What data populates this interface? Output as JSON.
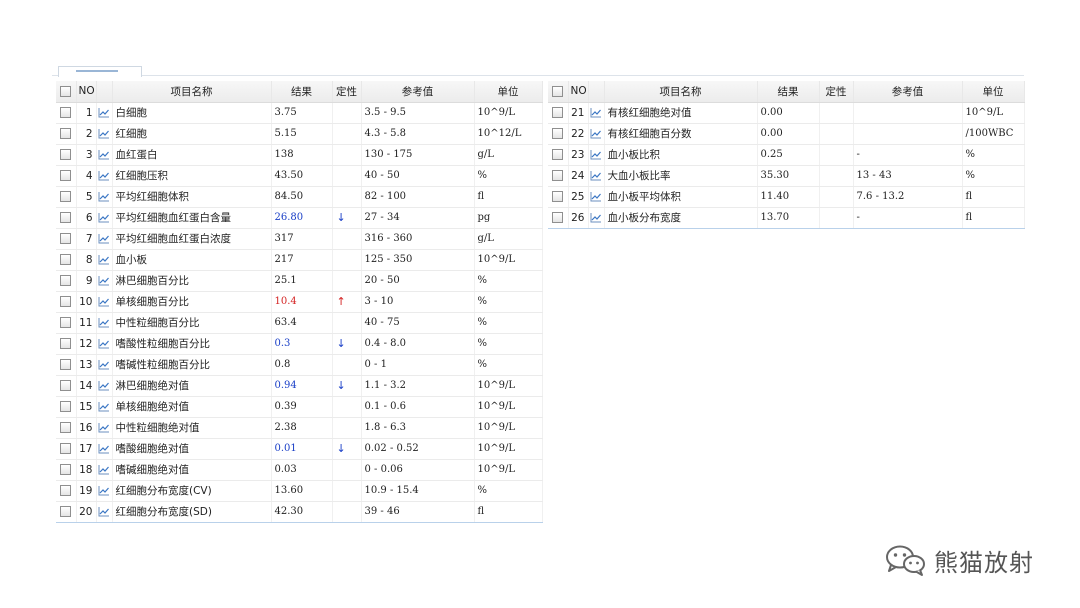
{
  "headers": {
    "no": "NO",
    "name": "项目名称",
    "result": "结果",
    "flag": "定性",
    "ref": "参考值",
    "unit": "单位"
  },
  "left_rows": [
    {
      "no": "1",
      "name": "白细胞",
      "result": "3.75",
      "flag": "",
      "ref": "3.5 - 9.5",
      "unit": "10^9/L",
      "status": "normal"
    },
    {
      "no": "2",
      "name": "红细胞",
      "result": "5.15",
      "flag": "",
      "ref": "4.3 - 5.8",
      "unit": "10^12/L",
      "status": "normal"
    },
    {
      "no": "3",
      "name": "血红蛋白",
      "result": "138",
      "flag": "",
      "ref": "130 - 175",
      "unit": "g/L",
      "status": "normal"
    },
    {
      "no": "4",
      "name": "红细胞压积",
      "result": "43.50",
      "flag": "",
      "ref": "40 - 50",
      "unit": "%",
      "status": "normal"
    },
    {
      "no": "5",
      "name": "平均红细胞体积",
      "result": "84.50",
      "flag": "",
      "ref": "82 - 100",
      "unit": "fl",
      "status": "normal"
    },
    {
      "no": "6",
      "name": "平均红细胞血红蛋白含量",
      "result": "26.80",
      "flag": "↓",
      "ref": "27 - 34",
      "unit": "pg",
      "status": "low"
    },
    {
      "no": "7",
      "name": "平均红细胞血红蛋白浓度",
      "result": "317",
      "flag": "",
      "ref": "316 - 360",
      "unit": "g/L",
      "status": "normal"
    },
    {
      "no": "8",
      "name": "血小板",
      "result": "217",
      "flag": "",
      "ref": "125 - 350",
      "unit": "10^9/L",
      "status": "normal"
    },
    {
      "no": "9",
      "name": "淋巴细胞百分比",
      "result": "25.1",
      "flag": "",
      "ref": "20 - 50",
      "unit": "%",
      "status": "normal"
    },
    {
      "no": "10",
      "name": "单核细胞百分比",
      "result": "10.4",
      "flag": "↑",
      "ref": "3 - 10",
      "unit": "%",
      "status": "high"
    },
    {
      "no": "11",
      "name": "中性粒细胞百分比",
      "result": "63.4",
      "flag": "",
      "ref": "40 - 75",
      "unit": "%",
      "status": "normal"
    },
    {
      "no": "12",
      "name": "嗜酸性粒细胞百分比",
      "result": "0.3",
      "flag": "↓",
      "ref": "0.4 - 8.0",
      "unit": "%",
      "status": "low"
    },
    {
      "no": "13",
      "name": "嗜碱性粒细胞百分比",
      "result": "0.8",
      "flag": "",
      "ref": "0 - 1",
      "unit": "%",
      "status": "normal"
    },
    {
      "no": "14",
      "name": "淋巴细胞绝对值",
      "result": "0.94",
      "flag": "↓",
      "ref": "1.1 - 3.2",
      "unit": "10^9/L",
      "status": "low"
    },
    {
      "no": "15",
      "name": "单核细胞绝对值",
      "result": "0.39",
      "flag": "",
      "ref": "0.1 - 0.6",
      "unit": "10^9/L",
      "status": "normal"
    },
    {
      "no": "16",
      "name": "中性粒细胞绝对值",
      "result": "2.38",
      "flag": "",
      "ref": "1.8 - 6.3",
      "unit": "10^9/L",
      "status": "normal"
    },
    {
      "no": "17",
      "name": "嗜酸细胞绝对值",
      "result": "0.01",
      "flag": "↓",
      "ref": "0.02 - 0.52",
      "unit": "10^9/L",
      "status": "low"
    },
    {
      "no": "18",
      "name": "嗜碱细胞绝对值",
      "result": "0.03",
      "flag": "",
      "ref": "0 - 0.06",
      "unit": "10^9/L",
      "status": "normal"
    },
    {
      "no": "19",
      "name": "红细胞分布宽度(CV)",
      "result": "13.60",
      "flag": "",
      "ref": "10.9 - 15.4",
      "unit": "%",
      "status": "normal"
    },
    {
      "no": "20",
      "name": "红细胞分布宽度(SD)",
      "result": "42.30",
      "flag": "",
      "ref": "39 - 46",
      "unit": "fl",
      "status": "normal"
    }
  ],
  "right_rows": [
    {
      "no": "21",
      "name": "有核红细胞绝对值",
      "result": "0.00",
      "flag": "",
      "ref": "",
      "unit": "10^9/L",
      "status": "normal"
    },
    {
      "no": "22",
      "name": "有核红细胞百分数",
      "result": "0.00",
      "flag": "",
      "ref": "",
      "unit": "/100WBC",
      "status": "normal"
    },
    {
      "no": "23",
      "name": "血小板比积",
      "result": "0.25",
      "flag": "",
      "ref": "-",
      "unit": "%",
      "status": "normal"
    },
    {
      "no": "24",
      "name": "大血小板比率",
      "result": "35.30",
      "flag": "",
      "ref": "13 - 43",
      "unit": "%",
      "status": "normal"
    },
    {
      "no": "25",
      "name": "血小板平均体积",
      "result": "11.40",
      "flag": "",
      "ref": "7.6 - 13.2",
      "unit": "fl",
      "status": "normal"
    },
    {
      "no": "26",
      "name": "血小板分布宽度",
      "result": "13.70",
      "flag": "",
      "ref": "-",
      "unit": "fl",
      "status": "normal"
    }
  ],
  "colors": {
    "low": "#1a3fc7",
    "high": "#d42424",
    "header_bg": "#ececec",
    "border": "#b9d1ea"
  },
  "icons": {
    "row": "line-chart-icon",
    "checkbox": "checkbox-icon",
    "watermark": "wechat-icon"
  },
  "watermark": {
    "text": "熊猫放射"
  }
}
